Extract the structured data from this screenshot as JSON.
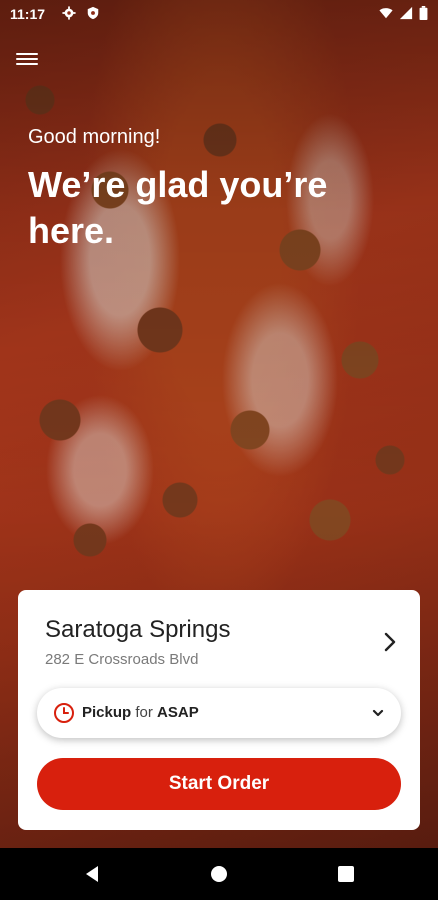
{
  "status_bar": {
    "time": "11:17",
    "left_icons": [
      "gear-icon",
      "shield-icon"
    ],
    "right_icons": [
      "wifi-icon",
      "signal-icon",
      "battery-icon"
    ]
  },
  "header": {
    "menu_icon": "hamburger-menu-icon",
    "greeting": "Good morning!",
    "headline": "We’re glad you’re here."
  },
  "store_card": {
    "name": "Saratoga Springs",
    "address": "282 E Crossroads Blvd",
    "pickup": {
      "mode": "Pickup",
      "connector": "for",
      "time": "ASAP"
    },
    "start_button_label": "Start Order"
  },
  "colors": {
    "accent": "#d8200d"
  }
}
